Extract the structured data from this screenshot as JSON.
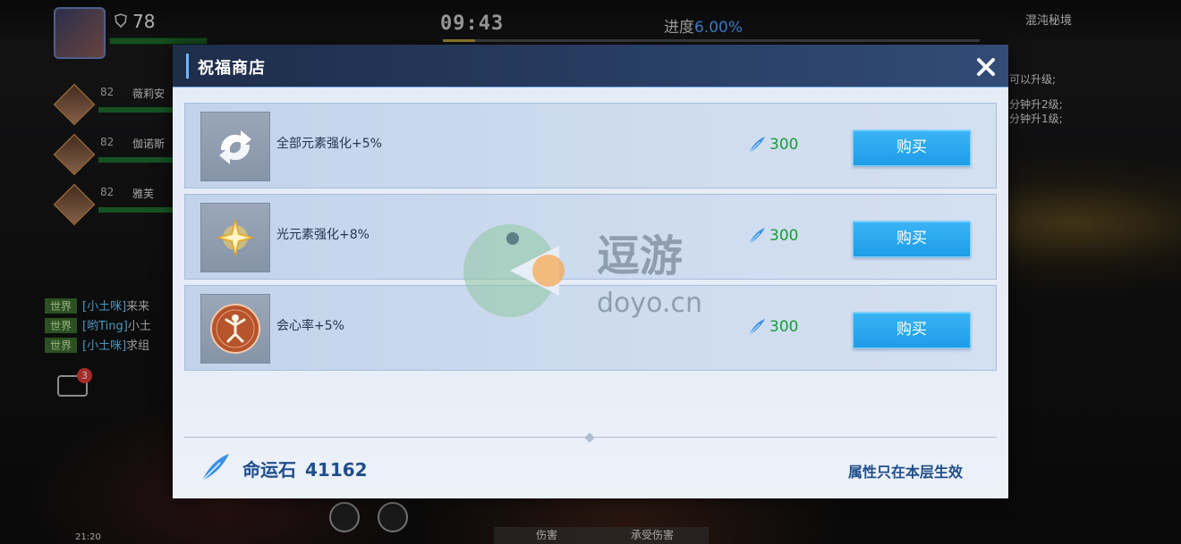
{
  "hud": {
    "level": "78",
    "timer": "09:43",
    "progress_label": "进度",
    "progress_value": "6.00%",
    "progress_fraction": 0.06,
    "party": [
      {
        "level": "82",
        "name": "薇莉安"
      },
      {
        "level": "82",
        "name": "伽诺斯"
      },
      {
        "level": "82",
        "name": "雅芙"
      }
    ],
    "chat": [
      {
        "channel": "世界",
        "who": "[小土咪]",
        "text": "来来"
      },
      {
        "channel": "世界",
        "who": "[哟Ting]",
        "text": "小土"
      },
      {
        "channel": "世界",
        "who": "[小土咪]",
        "text": "求组"
      }
    ],
    "chat_badge": "3",
    "dungeon_title": "混沌秘境",
    "right_texts": [
      "可以升级;",
      "分钟升2级;",
      "分钟升1级;"
    ],
    "bottom_tabs": [
      "伤害",
      "承受伤害"
    ],
    "clock": "21:20"
  },
  "shop": {
    "title": "祝福商店",
    "close_icon": "close-icon",
    "items": [
      {
        "name": "全部元素强化+5%",
        "icon": "element-cycle-icon",
        "price": "300",
        "buy_label": "购买"
      },
      {
        "name": "光元素强化+8%",
        "icon": "light-star-icon",
        "price": "300",
        "buy_label": "购买"
      },
      {
        "name": "会心率+5%",
        "icon": "critical-figure-icon",
        "price": "300",
        "buy_label": "购买"
      }
    ],
    "currency": {
      "label": "命运石",
      "amount": "41162",
      "icon": "destiny-stone-feather-icon"
    },
    "footer_note": "属性只在本层生效"
  },
  "watermark": {
    "brand": "逗游",
    "domain": "doyo.cn"
  },
  "colors": {
    "header_bg": "#263a5e",
    "buy_button": "#1d9ce8",
    "price_green": "#1a9c3a",
    "footer_text": "#1f4e8c"
  }
}
